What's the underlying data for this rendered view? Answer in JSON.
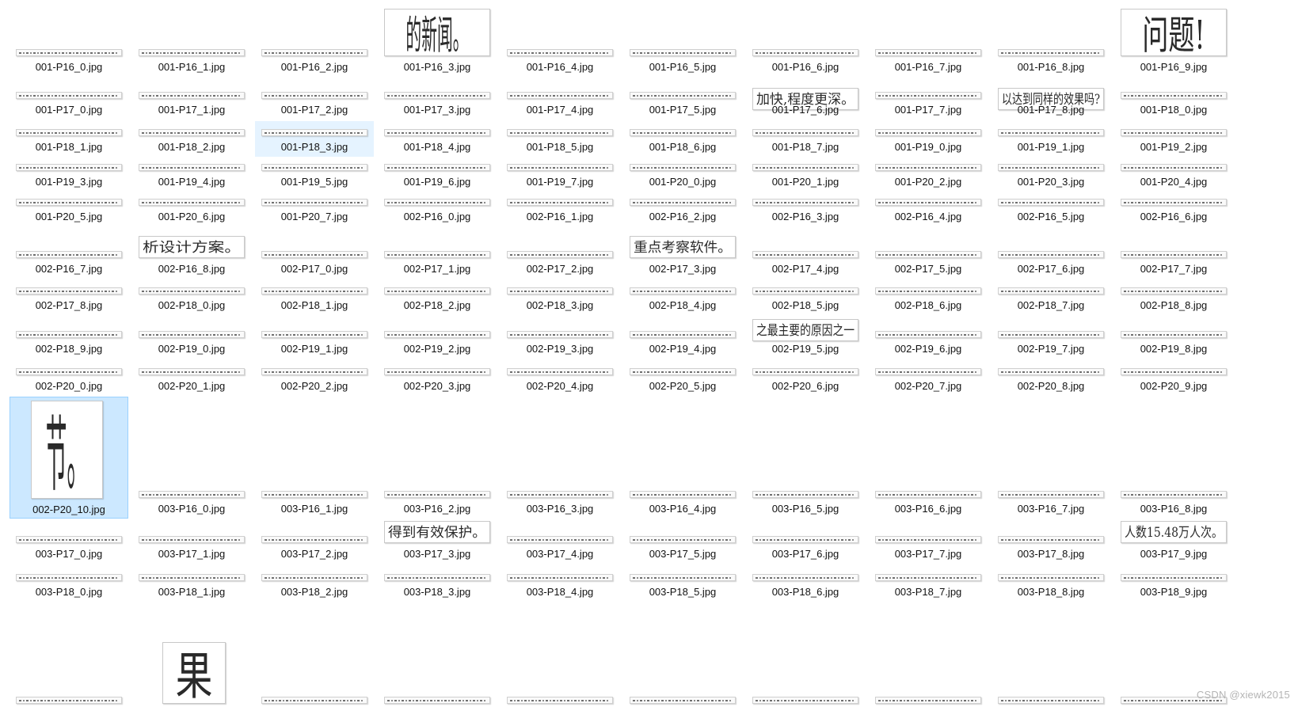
{
  "rows": [
    {
      "files": [
        {
          "name": "001-P16_0.jpg"
        },
        {
          "name": "001-P16_1.jpg"
        },
        {
          "name": "001-P16_2.jpg"
        },
        {
          "name": "001-P16_3.jpg",
          "thumb": "的新闻。"
        },
        {
          "name": "001-P16_4.jpg"
        },
        {
          "name": "001-P16_5.jpg"
        },
        {
          "name": "001-P16_6.jpg"
        },
        {
          "name": "001-P16_7.jpg"
        },
        {
          "name": "001-P16_8.jpg"
        },
        {
          "name": "001-P16_9.jpg",
          "thumb": "问题!"
        }
      ]
    },
    {
      "files": [
        {
          "name": "001-P17_0.jpg"
        },
        {
          "name": "001-P17_1.jpg"
        },
        {
          "name": "001-P17_2.jpg"
        },
        {
          "name": "001-P17_3.jpg"
        },
        {
          "name": "001-P17_4.jpg"
        },
        {
          "name": "001-P17_5.jpg"
        },
        {
          "name": "001-P17_6.jpg",
          "thumb": "加快,程度更深。"
        },
        {
          "name": "001-P17_7.jpg"
        },
        {
          "name": "001-P17_8.jpg",
          "thumb": "以达到同样的效果吗?"
        },
        {
          "name": "001-P18_0.jpg"
        }
      ]
    },
    {
      "files": [
        {
          "name": "001-P18_1.jpg"
        },
        {
          "name": "001-P18_2.jpg"
        },
        {
          "name": "001-P18_3.jpg"
        },
        {
          "name": "001-P18_4.jpg"
        },
        {
          "name": "001-P18_5.jpg"
        },
        {
          "name": "001-P18_6.jpg"
        },
        {
          "name": "001-P18_7.jpg"
        },
        {
          "name": "001-P19_0.jpg"
        },
        {
          "name": "001-P19_1.jpg"
        },
        {
          "name": "001-P19_2.jpg"
        }
      ]
    },
    {
      "files": [
        {
          "name": "001-P19_3.jpg"
        },
        {
          "name": "001-P19_4.jpg"
        },
        {
          "name": "001-P19_5.jpg"
        },
        {
          "name": "001-P19_6.jpg"
        },
        {
          "name": "001-P19_7.jpg"
        },
        {
          "name": "001-P20_0.jpg"
        },
        {
          "name": "001-P20_1.jpg"
        },
        {
          "name": "001-P20_2.jpg"
        },
        {
          "name": "001-P20_3.jpg"
        },
        {
          "name": "001-P20_4.jpg"
        }
      ]
    },
    {
      "files": [
        {
          "name": "001-P20_5.jpg"
        },
        {
          "name": "001-P20_6.jpg"
        },
        {
          "name": "001-P20_7.jpg"
        },
        {
          "name": "002-P16_0.jpg"
        },
        {
          "name": "002-P16_1.jpg"
        },
        {
          "name": "002-P16_2.jpg"
        },
        {
          "name": "002-P16_3.jpg"
        },
        {
          "name": "002-P16_4.jpg"
        },
        {
          "name": "002-P16_5.jpg"
        },
        {
          "name": "002-P16_6.jpg"
        }
      ]
    },
    {
      "files": [
        {
          "name": "002-P16_7.jpg"
        },
        {
          "name": "002-P16_8.jpg",
          "thumb": "析设计方案。"
        },
        {
          "name": "002-P17_0.jpg"
        },
        {
          "name": "002-P17_1.jpg"
        },
        {
          "name": "002-P17_2.jpg"
        },
        {
          "name": "002-P17_3.jpg",
          "thumb": "重点考察软件。"
        },
        {
          "name": "002-P17_4.jpg"
        },
        {
          "name": "002-P17_5.jpg"
        },
        {
          "name": "002-P17_6.jpg"
        },
        {
          "name": "002-P17_7.jpg"
        }
      ]
    },
    {
      "files": [
        {
          "name": "002-P17_8.jpg"
        },
        {
          "name": "002-P18_0.jpg"
        },
        {
          "name": "002-P18_1.jpg"
        },
        {
          "name": "002-P18_2.jpg"
        },
        {
          "name": "002-P18_3.jpg"
        },
        {
          "name": "002-P18_4.jpg"
        },
        {
          "name": "002-P18_5.jpg"
        },
        {
          "name": "002-P18_6.jpg"
        },
        {
          "name": "002-P18_7.jpg"
        },
        {
          "name": "002-P18_8.jpg"
        }
      ]
    },
    {
      "files": [
        {
          "name": "002-P18_9.jpg"
        },
        {
          "name": "002-P19_0.jpg"
        },
        {
          "name": "002-P19_1.jpg"
        },
        {
          "name": "002-P19_2.jpg"
        },
        {
          "name": "002-P19_3.jpg"
        },
        {
          "name": "002-P19_4.jpg"
        },
        {
          "name": "002-P19_5.jpg",
          "thumb": "之最主要的原因之一"
        },
        {
          "name": "002-P19_6.jpg"
        },
        {
          "name": "002-P19_7.jpg"
        },
        {
          "name": "002-P19_8.jpg"
        }
      ]
    },
    {
      "files": [
        {
          "name": "002-P20_0.jpg"
        },
        {
          "name": "002-P20_1.jpg"
        },
        {
          "name": "002-P20_2.jpg"
        },
        {
          "name": "002-P20_3.jpg"
        },
        {
          "name": "002-P20_4.jpg"
        },
        {
          "name": "002-P20_5.jpg"
        },
        {
          "name": "002-P20_6.jpg"
        },
        {
          "name": "002-P20_7.jpg"
        },
        {
          "name": "002-P20_8.jpg"
        },
        {
          "name": "002-P20_9.jpg"
        }
      ]
    },
    {
      "files": [
        {
          "name": "002-P20_10.jpg",
          "thumb": "节。",
          "selected": true
        },
        {
          "name": "003-P16_0.jpg"
        },
        {
          "name": "003-P16_1.jpg"
        },
        {
          "name": "003-P16_2.jpg"
        },
        {
          "name": "003-P16_3.jpg"
        },
        {
          "name": "003-P16_4.jpg"
        },
        {
          "name": "003-P16_5.jpg"
        },
        {
          "name": "003-P16_6.jpg"
        },
        {
          "name": "003-P16_7.jpg"
        },
        {
          "name": "003-P16_8.jpg"
        }
      ]
    },
    {
      "files": [
        {
          "name": "003-P17_0.jpg"
        },
        {
          "name": "003-P17_1.jpg"
        },
        {
          "name": "003-P17_2.jpg"
        },
        {
          "name": "003-P17_3.jpg",
          "thumb": "得到有效保护。"
        },
        {
          "name": "003-P17_4.jpg"
        },
        {
          "name": "003-P17_5.jpg"
        },
        {
          "name": "003-P17_6.jpg"
        },
        {
          "name": "003-P17_7.jpg"
        },
        {
          "name": "003-P17_8.jpg"
        },
        {
          "name": "003-P17_9.jpg",
          "thumb": "人数15.48万人次。"
        }
      ]
    },
    {
      "files": [
        {
          "name": "003-P18_0.jpg"
        },
        {
          "name": "003-P18_1.jpg"
        },
        {
          "name": "003-P18_2.jpg"
        },
        {
          "name": "003-P18_3.jpg"
        },
        {
          "name": "003-P18_4.jpg"
        },
        {
          "name": "003-P18_5.jpg"
        },
        {
          "name": "003-P18_6.jpg"
        },
        {
          "name": "003-P18_7.jpg"
        },
        {
          "name": "003-P18_8.jpg"
        },
        {
          "name": "003-P18_9.jpg"
        }
      ]
    },
    {
      "files": [
        {
          "name": ""
        },
        {
          "name": "",
          "thumb": "果"
        },
        {
          "name": ""
        },
        {
          "name": ""
        },
        {
          "name": ""
        },
        {
          "name": ""
        },
        {
          "name": ""
        },
        {
          "name": ""
        },
        {
          "name": ""
        },
        {
          "name": ""
        }
      ]
    }
  ],
  "hovered": "001-P18_3.jpg",
  "watermark": "CSDN @xiewk2015",
  "colors": {
    "selected_bg": "#cce8ff",
    "hover_bg": "#e5f3ff"
  }
}
